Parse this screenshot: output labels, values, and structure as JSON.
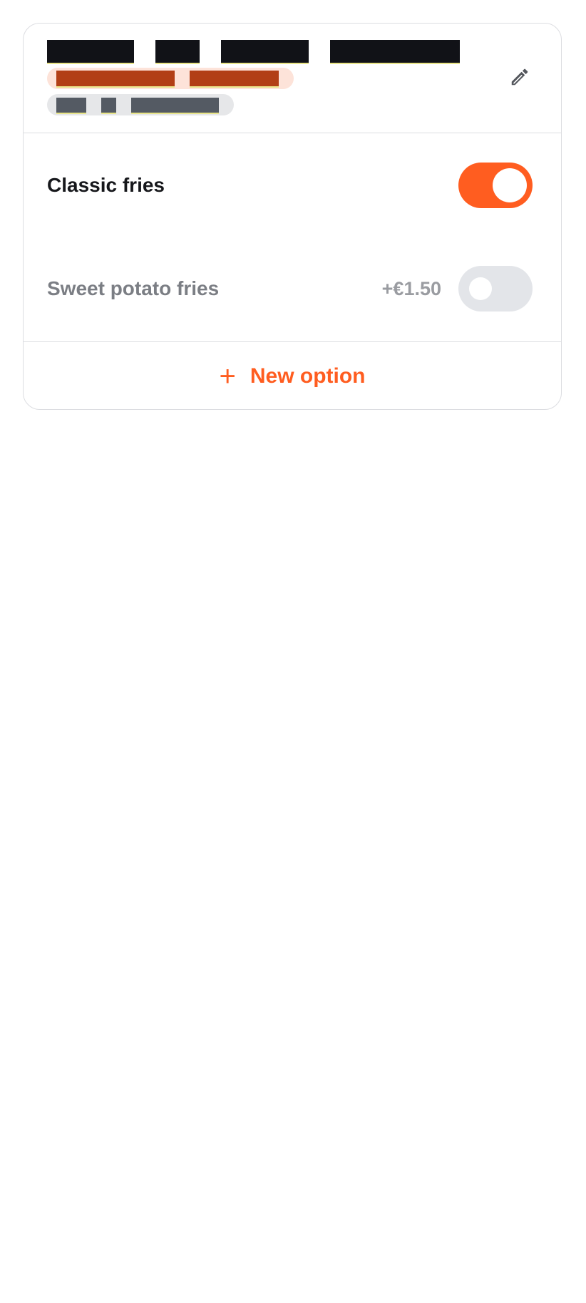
{
  "group": {
    "title_redacted_segments": 4,
    "tag_redacted_segments": 2,
    "meta_redacted_segments": 3,
    "edit_icon": "pencil-icon"
  },
  "options": [
    {
      "label": "Classic fries",
      "price": "",
      "enabled": true
    },
    {
      "label": "Sweet potato fries",
      "price": "+€1.50",
      "enabled": false
    }
  ],
  "footer": {
    "icon": "plus-icon",
    "label": "New option"
  },
  "colors": {
    "accent": "#ff5d20",
    "toggle_off": "#e3e5e9",
    "tag_bg": "#fde3d9",
    "redaction": "#111217"
  }
}
